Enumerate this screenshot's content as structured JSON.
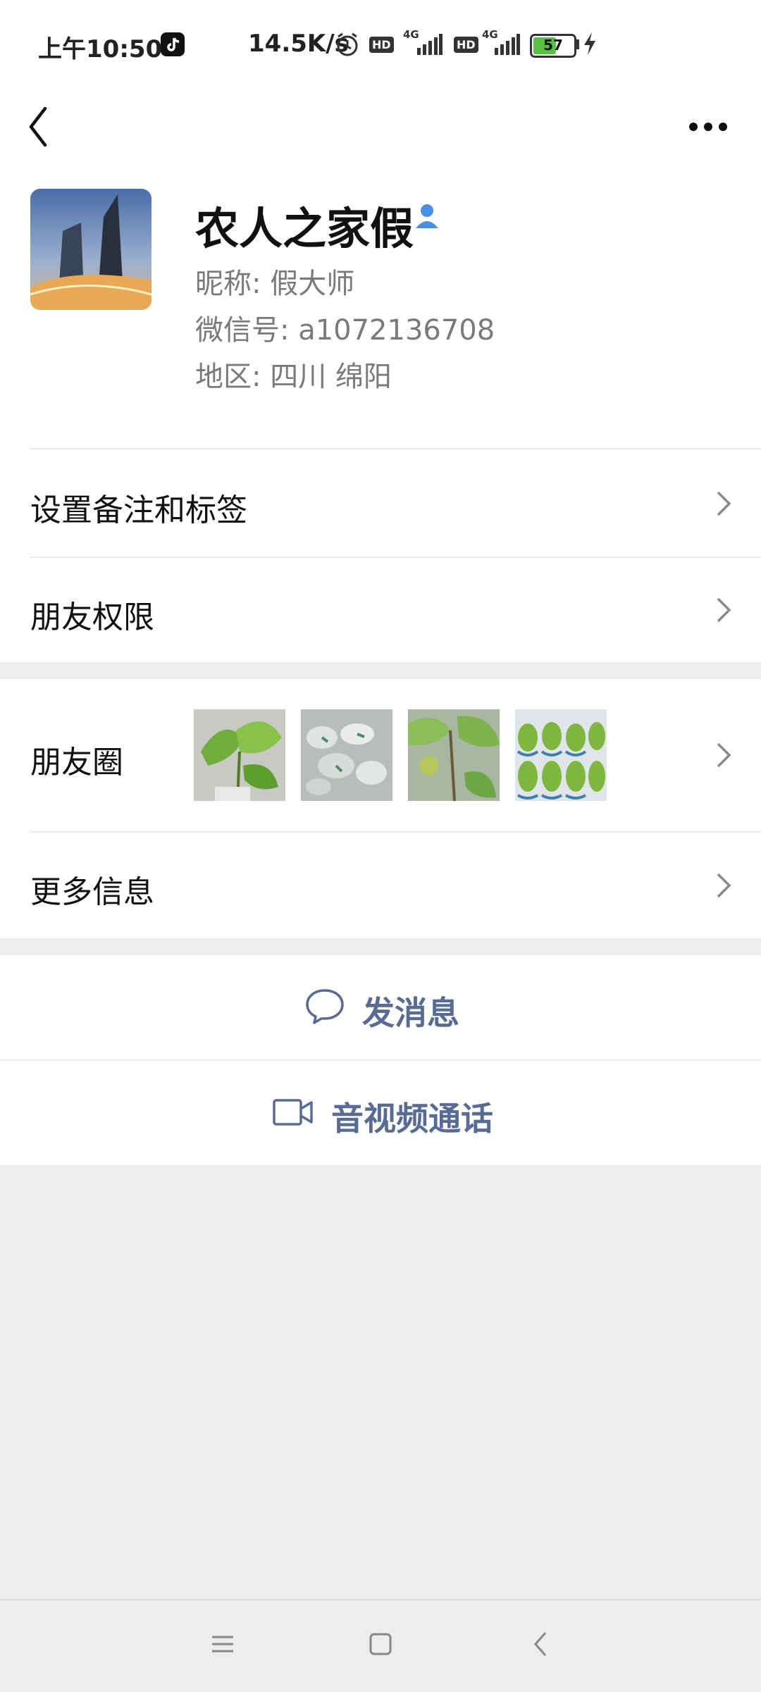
{
  "status_bar": {
    "time": "上午10:50",
    "net_speed": "14.5K/s",
    "network_1": "4G",
    "network_2": "4G",
    "hd_1": "HD",
    "hd_2": "HD",
    "battery": "57"
  },
  "profile": {
    "name": "农人之家假",
    "nickname_line": "昵称:  假大师",
    "wechat_id_line": "微信号:  a1072136708",
    "region_line": "地区:  四川  绵阳"
  },
  "rows": {
    "remark": "设置备注和标签",
    "permissions": "朋友权限",
    "moments": "朋友圈",
    "more_info": "更多信息"
  },
  "actions": {
    "message": "发消息",
    "call": "音视频通话"
  },
  "colors": {
    "link": "#576b95",
    "background": "#ededed",
    "verified_icon": "#4a90e2"
  }
}
